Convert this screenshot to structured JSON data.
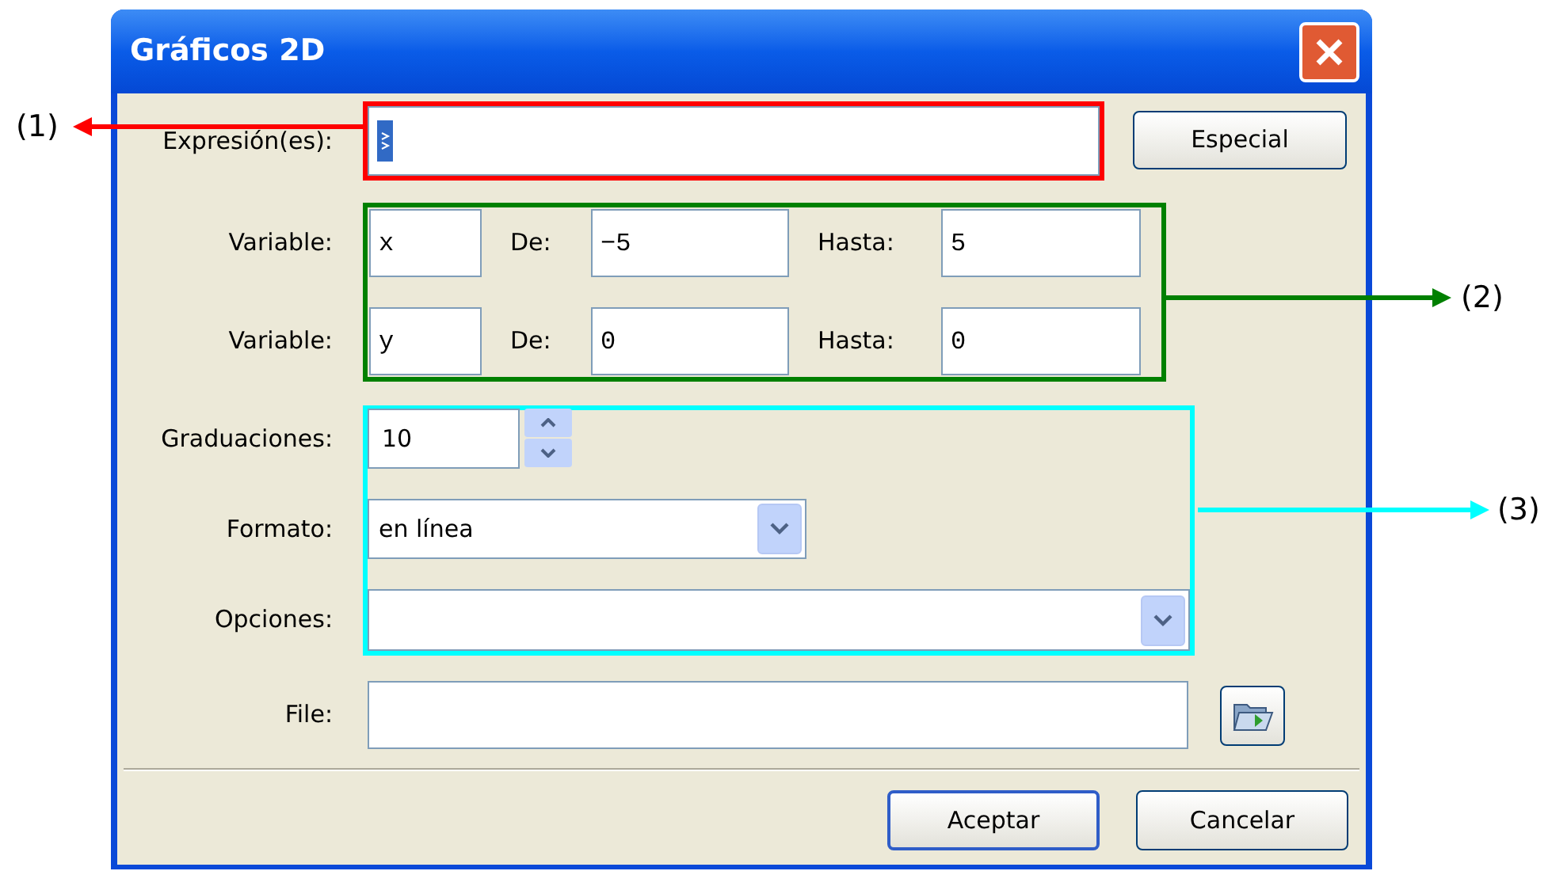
{
  "window": {
    "title": "Gráficos 2D"
  },
  "expression": {
    "label": "Expresión(es):",
    "button": "Especial"
  },
  "variables": [
    {
      "label": "Variable:",
      "name": "x",
      "from_label": "De:",
      "from": "−5",
      "to_label": "Hasta:",
      "to": "5"
    },
    {
      "label": "Variable:",
      "name": "y",
      "from_label": "De:",
      "from": "0",
      "to_label": "Hasta:",
      "to": "0"
    }
  ],
  "graduations": {
    "label": "Graduaciones:",
    "value": "10"
  },
  "format": {
    "label": "Formato:",
    "value": "en línea"
  },
  "options": {
    "label": "Opciones:"
  },
  "file": {
    "label": "File:"
  },
  "buttons": [
    {
      "label": "Aceptar",
      "default": true
    },
    {
      "label": "Cancelar",
      "default": false
    }
  ],
  "annotations": [
    {
      "label": "(1)",
      "color": "#ff0000"
    },
    {
      "label": "(2)",
      "color": "#008000"
    },
    {
      "label": "(3)",
      "color": "#00ffff"
    }
  ]
}
